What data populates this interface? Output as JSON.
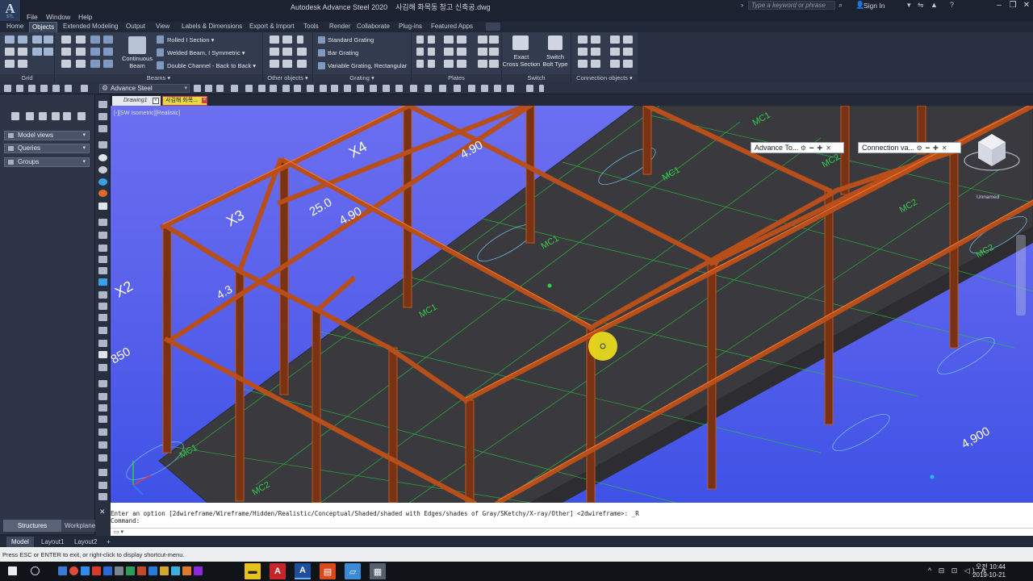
{
  "window": {
    "logo_text": "A",
    "logo_sub": "STL",
    "app_title": "Autodesk Advance Steel 2020",
    "file_title": "사김해 화목동 창고 신축공.dwg",
    "search_placeholder": "Type a keyword or phrase",
    "sign_in": "Sign In",
    "minimize": "–",
    "restore": "❐",
    "close": "✕"
  },
  "menu": [
    "File",
    "Window",
    "Help"
  ],
  "ribbon_tabs": [
    {
      "label": "Home",
      "active": false
    },
    {
      "label": "Objects",
      "active": true
    },
    {
      "label": "Extended Modeling",
      "active": false
    },
    {
      "label": "Output",
      "active": false
    },
    {
      "label": "View",
      "active": false
    },
    {
      "label": "Labels & Dimensions",
      "active": false
    },
    {
      "label": "Export & Import",
      "active": false
    },
    {
      "label": "Tools",
      "active": false
    },
    {
      "label": "Render",
      "active": false
    },
    {
      "label": "Collaborate",
      "active": false
    },
    {
      "label": "Plug-ins",
      "active": false
    },
    {
      "label": "Featured Apps",
      "active": false
    }
  ],
  "ribbon": {
    "groups": {
      "grid": "Grid",
      "beams": "Beams ▾",
      "other_objects": "Other objects ▾",
      "grating": "Grating ▾",
      "plates": "Plates",
      "switch": "Switch",
      "connection_objects": "Connection objects ▾"
    },
    "continuous_beam": "Continuous\nBeam",
    "beam_items": [
      "Rolled I Section ▾",
      "Welded Beam, I Symmetric ▾",
      "Double Channel - Back to Back ▾"
    ],
    "grating_items": [
      "Standard Grating",
      "Bar Grating",
      "Variable Grating, Rectangular"
    ],
    "exact_cross_section": "Exact\nCross Section",
    "switch_bolt_type": "Switch\nBolt Type"
  },
  "quickbar": {
    "workspace": "Advance Steel"
  },
  "palette": {
    "accordions": [
      "Model views",
      "Queries",
      "Groups"
    ],
    "tabs": [
      "Structures",
      "Workplane"
    ]
  },
  "file_tabs": {
    "drawing": "Drawing1",
    "current": "사김해 화목..."
  },
  "viewport": {
    "view_label": "[-][SW Isometric][Realistic]",
    "popup_advance": "Advance To...",
    "popup_connection": "Connection va...",
    "popup_controls": "⚙ ━ ✚ ✕",
    "viewcube_label": "Unnamed",
    "labels": {
      "x2": "X2",
      "x3": "X3",
      "x4": "X4",
      "d1": "4.90",
      "d2": "25.0",
      "d3": "4.90",
      "d4": "4,900",
      "d5": "850",
      "mc1": "MC1",
      "mc2": "MC2",
      "d6": "4.3"
    }
  },
  "command": {
    "history": "Enter an option [2dwireframe/Wireframe/Hidden/Realistic/Conceptual/Shaded/shaded with Edges/shades of Gray/SKetchy/X-ray/Other] <2dwireframe>: _R",
    "prompt": "Command:",
    "input_placeholder": "▭ ▾"
  },
  "layouts": [
    "Model",
    "Layout1",
    "Layout2",
    "+"
  ],
  "status": {
    "message": "Press ESC or ENTER to exit, or right-click to display shortcut-menu."
  },
  "taskbar": {
    "time": "오전 10:44",
    "date": "2019-10-21",
    "tray": "^ ⊟ ⊡ ◁) A"
  }
}
